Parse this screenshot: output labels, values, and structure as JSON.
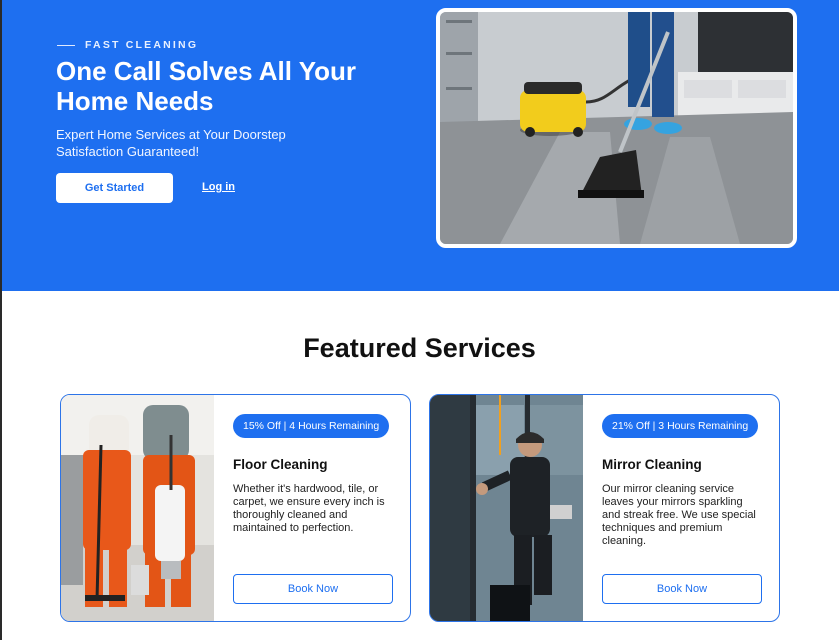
{
  "hero": {
    "eyebrow": "FAST CLEANING",
    "title": "One Call Solves All Your Home Needs",
    "subtitle": "Expert Home Services at Your Doorstep Satisfaction Guaranteed!",
    "primary_button": "Get Started",
    "login_link": "Log in"
  },
  "featured": {
    "title": "Featured Services",
    "cards": [
      {
        "badge": "15% Off | 4 Hours Remaining",
        "title": "Floor Cleaning",
        "description": "Whether it's hardwood, tile, or carpet, we ensure every inch is thoroughly cleaned and maintained to perfection.",
        "button": "Book Now"
      },
      {
        "badge": "21% Off | 3 Hours Remaining",
        "title": "Mirror Cleaning",
        "description": "Our mirror cleaning service leaves your mirrors sparkling and streak free. We use special techniques and premium cleaning.",
        "button": "Book Now"
      }
    ]
  },
  "colors": {
    "brand_blue": "#1e6ff0",
    "white": "#ffffff"
  }
}
